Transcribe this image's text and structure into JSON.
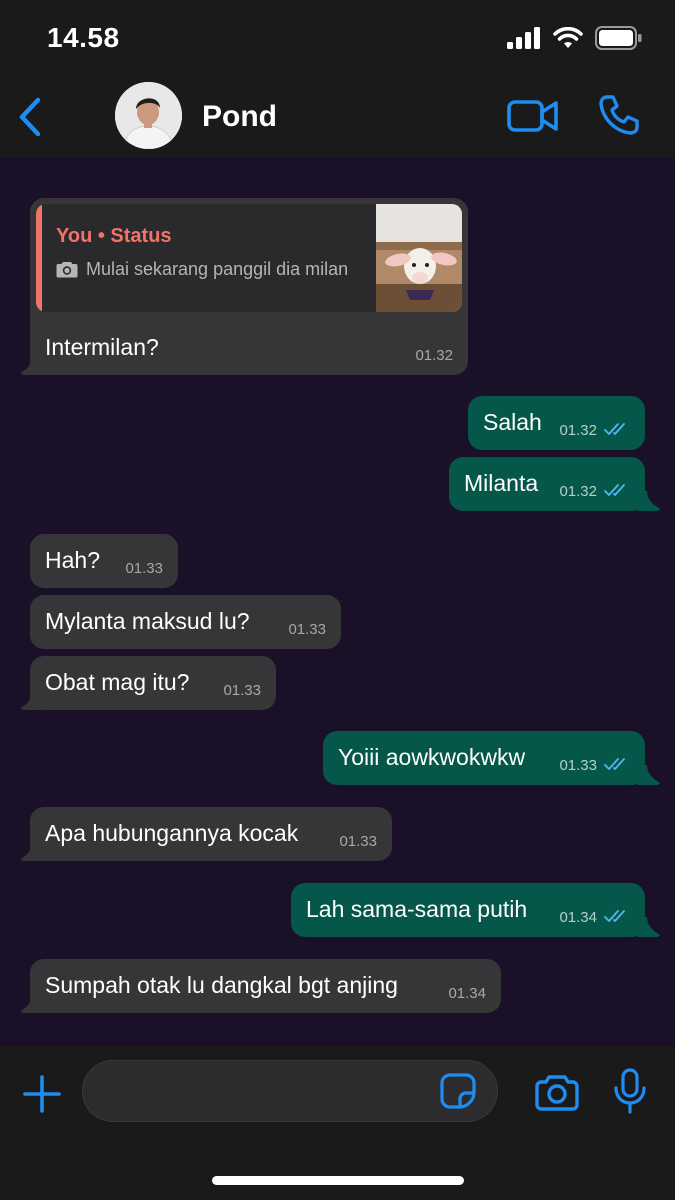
{
  "status_bar": {
    "time": "14.58"
  },
  "header": {
    "contact_name": "Pond"
  },
  "colors": {
    "accent": "#1e8cf0",
    "incoming": "#363638",
    "outgoing": "#05574a",
    "reply_author": "#f07468",
    "read_ticks": "#4fb8f5"
  },
  "icons": {
    "back": "chevron-left-icon",
    "video": "video-camera-icon",
    "call": "phone-icon",
    "plus": "plus-icon",
    "sticker": "sticker-icon",
    "camera": "camera-icon",
    "mic": "microphone-icon"
  },
  "messages": [
    {
      "direction": "in",
      "text": "Intermilan?",
      "time": "01.32",
      "reply": {
        "author": "You • Status",
        "text": "Mulai sekarang panggil dia milan"
      }
    },
    {
      "direction": "out",
      "text": "Salah",
      "time": "01.32",
      "status": "read"
    },
    {
      "direction": "out",
      "text": "Milanta",
      "time": "01.32",
      "status": "read"
    },
    {
      "direction": "in",
      "text": "Hah?",
      "time": "01.33"
    },
    {
      "direction": "in",
      "text": "Mylanta maksud lu?",
      "time": "01.33"
    },
    {
      "direction": "in",
      "text": "Obat mag itu?",
      "time": "01.33"
    },
    {
      "direction": "out",
      "text": "Yoiii aowkwokwkw",
      "time": "01.33",
      "status": "read"
    },
    {
      "direction": "in",
      "text": "Apa hubungannya kocak",
      "time": "01.33"
    },
    {
      "direction": "out",
      "text": "Lah sama-sama putih",
      "time": "01.34",
      "status": "read"
    },
    {
      "direction": "in",
      "text": "Sumpah otak lu dangkal bgt anjing",
      "time": "01.34"
    }
  ],
  "composer": {
    "value": ""
  }
}
